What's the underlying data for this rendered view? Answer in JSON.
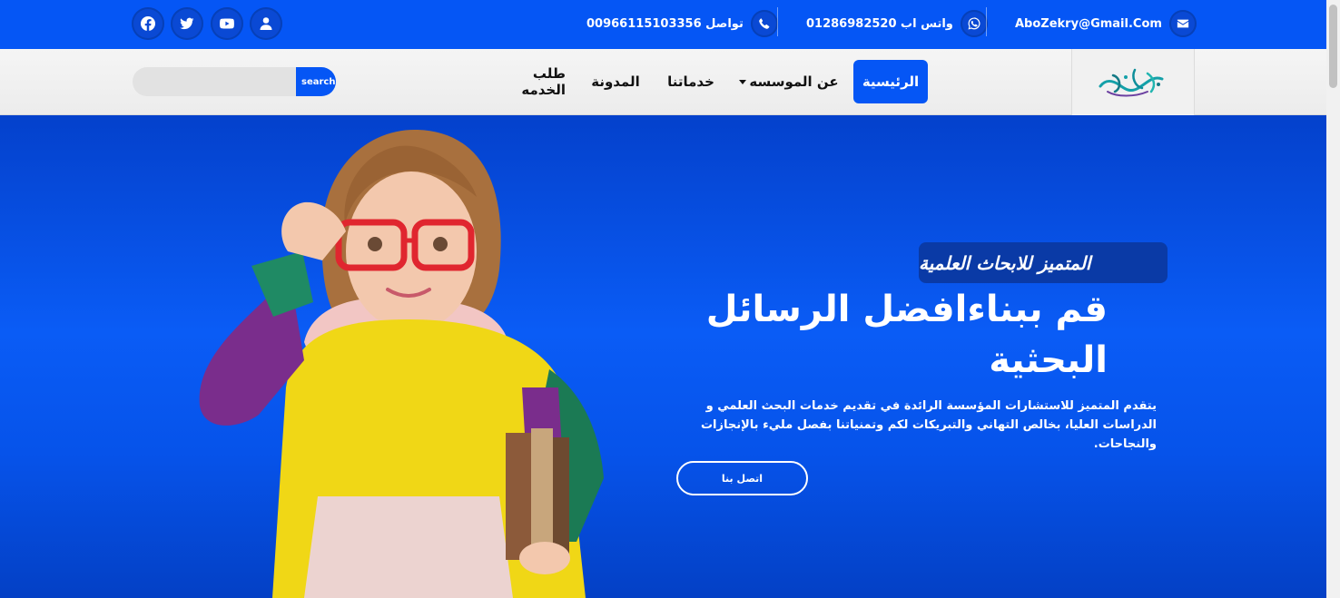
{
  "topbar": {
    "email": "AboZekry@Gmail.Com",
    "whatsapp_label": "واتس اب 01286982520",
    "phone_label": "تواصل 00966115103356",
    "social": [
      "facebook-icon",
      "twitter-icon",
      "youtube-icon",
      "user-icon"
    ]
  },
  "nav": {
    "items": [
      "الرئيسية",
      "عن الموسسه",
      "خدماتنا",
      "المدونة",
      "طلب الخدمه"
    ],
    "search_placeholder": "",
    "search_button": "search"
  },
  "hero": {
    "tagline": "المتميز للابحاث العلمية",
    "headline": "قم ببناءافضل الرسائل البحثية",
    "description": "يتقدم المتميز للاستشارات المؤسسة الرائدة في تقديم خدمات البحث العلمي و الدراسات العليا، بخالص التهاني والتبريكات لكم وتمنياتنا بفصل مليء بالإنجازات والنجاحات.",
    "cta": "اتصل بنا"
  },
  "colors": {
    "brand_blue": "#0556f5",
    "hero_blue": "#0a5cf6"
  }
}
